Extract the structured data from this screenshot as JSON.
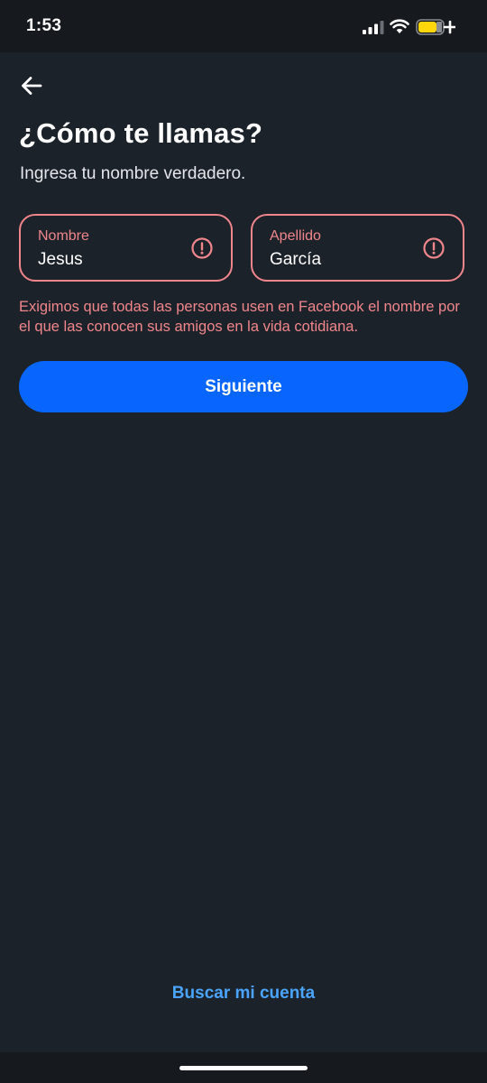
{
  "status_bar": {
    "time": "1:53",
    "signal_icon": "cellular-signal-icon",
    "wifi_icon": "wifi-icon",
    "battery_icon": "battery-charging-icon",
    "battery_color": "#ffd60a"
  },
  "header": {
    "back_icon": "arrow-left-icon",
    "title": "¿Cómo te llamas?",
    "subtitle": "Ingresa tu nombre verdadero."
  },
  "form": {
    "first_name": {
      "label": "Nombre",
      "value": "Jesus",
      "status_icon": "error-circle-icon"
    },
    "last_name": {
      "label": "Apellido",
      "value": "García",
      "status_icon": "error-circle-icon"
    },
    "error_message": "Exigimos que todas las personas usen en Facebook el nombre por el que las conocen sus amigos en la vida cotidiana.",
    "submit_label": "Siguiente"
  },
  "footer": {
    "find_account_label": "Buscar mi cuenta"
  },
  "colors": {
    "background": "#1c2229",
    "error": "#f0868b",
    "primary": "#0866ff",
    "link": "#4aa4ff"
  }
}
